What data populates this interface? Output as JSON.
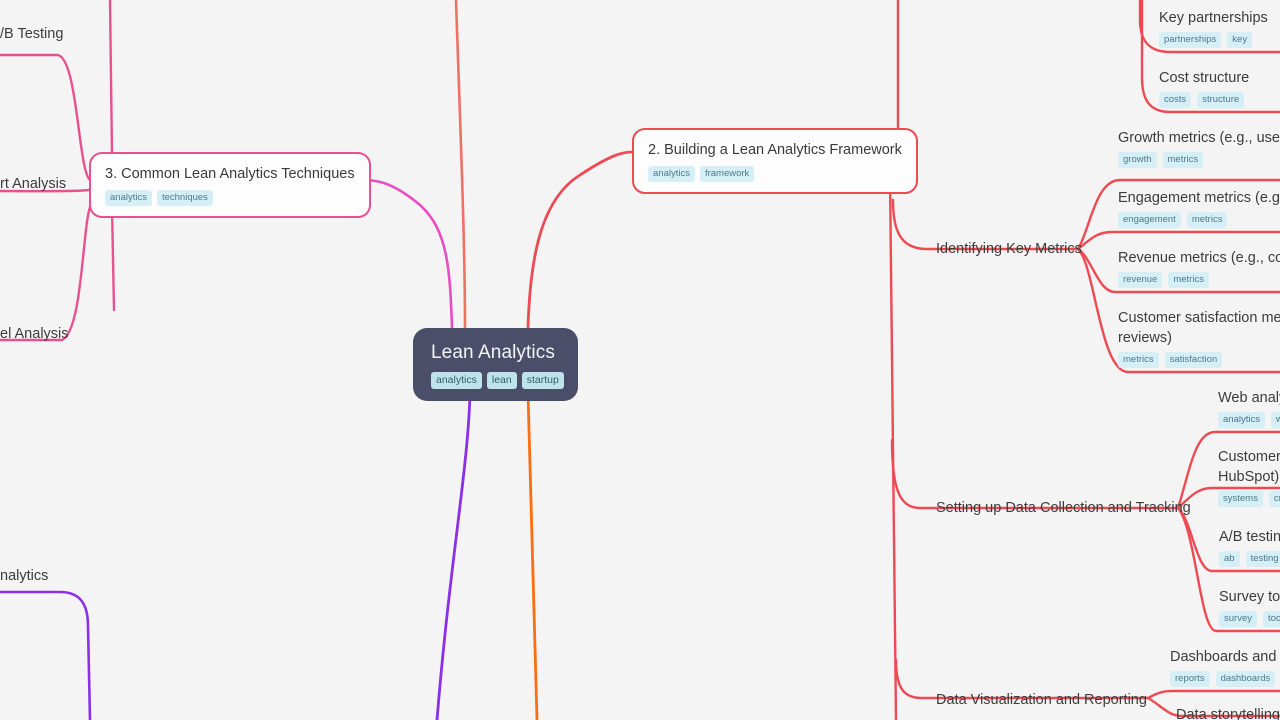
{
  "canvas": {
    "background_color": "#f4f4f5",
    "type": "mindmap"
  },
  "root": {
    "title": "Lean Analytics",
    "tags": [
      "analytics",
      "lean",
      "startup"
    ],
    "fill_color": "#4a4e69",
    "text_color": "#f4f4f6"
  },
  "branches": [
    {
      "id": "branch-framework",
      "title": "2. Building a Lean Analytics Framework",
      "tags": [
        "analytics",
        "framework"
      ],
      "color": "#ee4a53",
      "style": "boxed"
    },
    {
      "id": "branch-techniques",
      "title": "3. Common Lean Analytics Techniques",
      "tags": [
        "analytics",
        "techniques"
      ],
      "color": "#e8518f",
      "style": "boxed"
    }
  ],
  "sub_branches": [
    {
      "id": "sub-key-metrics",
      "label": "Identifying Key Metrics",
      "color": "#ee4a53"
    },
    {
      "id": "sub-data-collection",
      "label": "Setting up Data Collection and Tracking",
      "color": "#ee4a53"
    },
    {
      "id": "sub-data-viz",
      "label": "Data Visualization and Reporting",
      "color": "#ee4a53"
    }
  ],
  "leaves": {
    "business_model": [
      {
        "id": "leaf-key-partnerships",
        "title": "Key partnerships",
        "tags": [
          "partnerships",
          "key"
        ]
      },
      {
        "id": "leaf-cost-structure",
        "title": "Cost structure",
        "tags": [
          "costs",
          "structure"
        ]
      }
    ],
    "key_metrics": [
      {
        "id": "leaf-growth-metrics",
        "title": "Growth metrics (e.g., user a",
        "tags": [
          "growth",
          "metrics"
        ]
      },
      {
        "id": "leaf-engagement-metrics",
        "title": "Engagement metrics (e.g., ",
        "tags": [
          "engagement",
          "metrics"
        ]
      },
      {
        "id": "leaf-revenue-metrics",
        "title": "Revenue metrics (e.g., conv",
        "tags": [
          "revenue",
          "metrics"
        ]
      },
      {
        "id": "leaf-satisfaction-metrics",
        "title": "Customer satisfaction metr\nreviews)",
        "tags": [
          "metrics",
          "satisfaction"
        ]
      }
    ],
    "data_collection": [
      {
        "id": "leaf-web-analytics",
        "title": "Web analy",
        "tags": [
          "analytics",
          "w"
        ]
      },
      {
        "id": "leaf-crm-systems",
        "title": "Customer \nHubSpot)",
        "tags": [
          "systems",
          "cr"
        ]
      },
      {
        "id": "leaf-ab-testing",
        "title": "A/B testing",
        "tags": [
          "ab",
          "testing"
        ]
      },
      {
        "id": "leaf-survey-tools",
        "title": "Survey too",
        "tags": [
          "survey",
          "too"
        ]
      }
    ],
    "data_viz": [
      {
        "id": "leaf-dashboards",
        "title": "Dashboards and",
        "tags": [
          "reports",
          "dashboards"
        ]
      },
      {
        "id": "leaf-storytelling",
        "title": "Data storytelling",
        "tags": []
      }
    ],
    "techniques": [
      {
        "id": "leaf-ab-testing-left",
        "title": "/B Testing",
        "tags": []
      },
      {
        "id": "leaf-cohort-analysis",
        "title": "rt Analysis",
        "tags": []
      },
      {
        "id": "leaf-funnel-analysis",
        "title": "el Analysis",
        "tags": []
      }
    ],
    "bottom_left": [
      {
        "id": "leaf-bottom-analytics",
        "title": "nalytics",
        "tags": []
      }
    ]
  },
  "edge_colors": {
    "pink": "#e8518f",
    "magenta": "#e84ec0",
    "red": "#ee4a53",
    "salmon": "#ef7065",
    "purple": "#8b2fe8",
    "orange": "#f96f11"
  }
}
